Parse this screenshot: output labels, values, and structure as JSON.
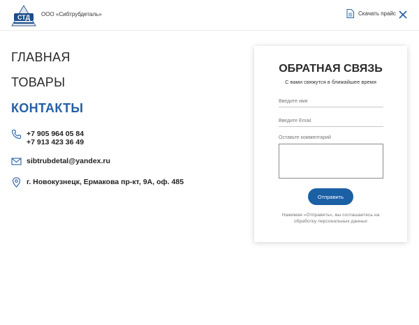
{
  "header": {
    "company_name": "ООО «Сибтрубдеталь»",
    "price_link_label": "Скачать прайс",
    "logo_letters": "СТД"
  },
  "nav": {
    "items": [
      {
        "label": "ГЛАВНАЯ",
        "active": false
      },
      {
        "label": "ТОВАРЫ",
        "active": false
      },
      {
        "label": "КОНТАКТЫ",
        "active": true
      }
    ]
  },
  "contacts": {
    "phone_1": "+7 905 964 05 84",
    "phone_2": "+7 913 423 36 49",
    "email": "sibtrubdetal@yandex.ru",
    "address": "г. Новокузнецк, Ермакова пр-кт, 9А, оф. 485"
  },
  "form": {
    "title": "ОБРАТНАЯ СВЯЗЬ",
    "subtitle": "С вами свяжутся в ближайшее время",
    "name_placeholder": "Введите имя",
    "email_placeholder": "Введите Email",
    "comment_label": "Оставьте комментарий",
    "submit_label": "Отправить",
    "disclaimer_line_1": "Нажимая «Отправить», вы соглашаетесь на",
    "disclaimer_line_2": "обработку персональных данных"
  },
  "colors": {
    "accent": "#2660a4",
    "button": "#1b5fa5",
    "text": "#222222"
  },
  "icons": {
    "logo": "company-logo",
    "price": "document-icon",
    "close": "close-icon",
    "phone": "phone-icon",
    "email": "envelope-icon",
    "address": "map-pin-icon"
  }
}
